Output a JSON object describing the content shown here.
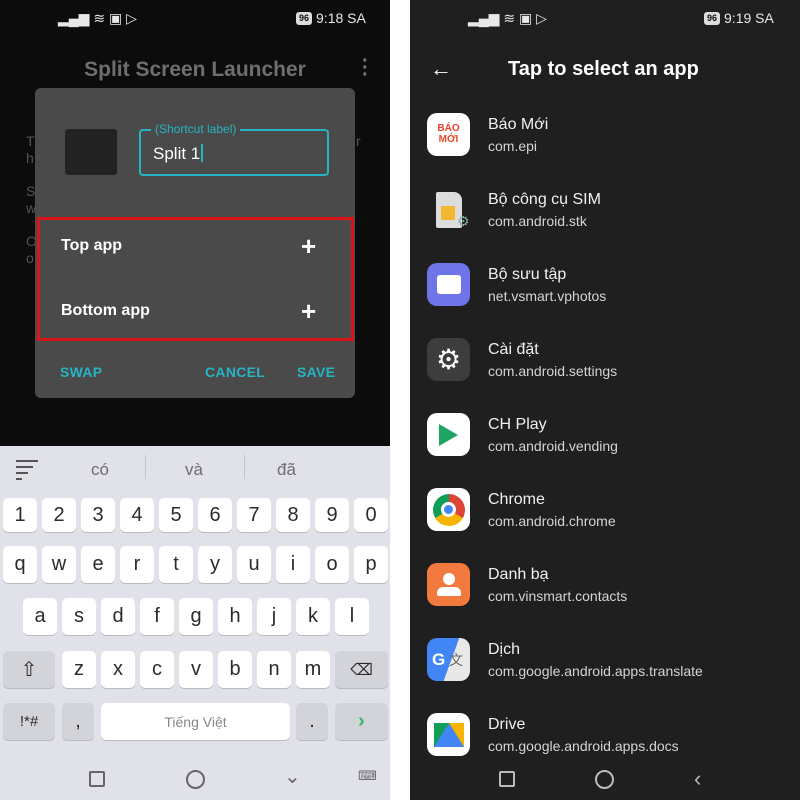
{
  "left": {
    "status": {
      "time": "9:18 SA",
      "battery": "96"
    },
    "app_title": "Split Screen Launcher",
    "background_text": [
      "T",
      "h",
      "S",
      "w",
      "O",
      "o",
      "r"
    ],
    "dialog": {
      "field_label": "(Shortcut label)",
      "field_value": "Split 1",
      "top_app": "Top app",
      "bottom_app": "Bottom app",
      "swap": "SWAP",
      "cancel": "CANCEL",
      "save": "SAVE",
      "accent": "#27b4c4",
      "highlight": "#d9141a"
    },
    "keyboard": {
      "suggestions": [
        "có",
        "và",
        "đã"
      ],
      "rows": [
        [
          "1",
          "2",
          "3",
          "4",
          "5",
          "6",
          "7",
          "8",
          "9",
          "0"
        ],
        [
          "q",
          "w",
          "e",
          "r",
          "t",
          "y",
          "u",
          "i",
          "o",
          "p"
        ],
        [
          "a",
          "s",
          "d",
          "f",
          "g",
          "h",
          "j",
          "k",
          "l"
        ],
        [
          "z",
          "x",
          "c",
          "v",
          "b",
          "n",
          "m"
        ]
      ],
      "symbols": "!*#",
      "comma": ",",
      "space": "Tiếng Việt",
      "period": ".",
      "enter": "›"
    }
  },
  "right": {
    "status": {
      "time": "9:19 SA",
      "battery": "96"
    },
    "title": "Tap to select an app",
    "apps": [
      {
        "name": "Báo Mới",
        "pkg": "com.epi",
        "icon": "bao-moi-icon"
      },
      {
        "name": "Bộ công cụ SIM",
        "pkg": "com.android.stk",
        "icon": "sim-icon"
      },
      {
        "name": "Bộ sưu tập",
        "pkg": "net.vsmart.vphotos",
        "icon": "gallery-icon"
      },
      {
        "name": "Cài đặt",
        "pkg": "com.android.settings",
        "icon": "settings-gear-icon"
      },
      {
        "name": "CH Play",
        "pkg": "com.android.vending",
        "icon": "play-store-icon"
      },
      {
        "name": "Chrome",
        "pkg": "com.android.chrome",
        "icon": "chrome-icon"
      },
      {
        "name": "Danh bạ",
        "pkg": "com.vinsmart.contacts",
        "icon": "contacts-icon"
      },
      {
        "name": "Dịch",
        "pkg": "com.google.android.apps.translate",
        "icon": "translate-icon"
      },
      {
        "name": "Drive",
        "pkg": "com.google.android.apps.docs",
        "icon": "drive-icon"
      }
    ],
    "bao_moi_logo": "BÁO MỚI"
  }
}
